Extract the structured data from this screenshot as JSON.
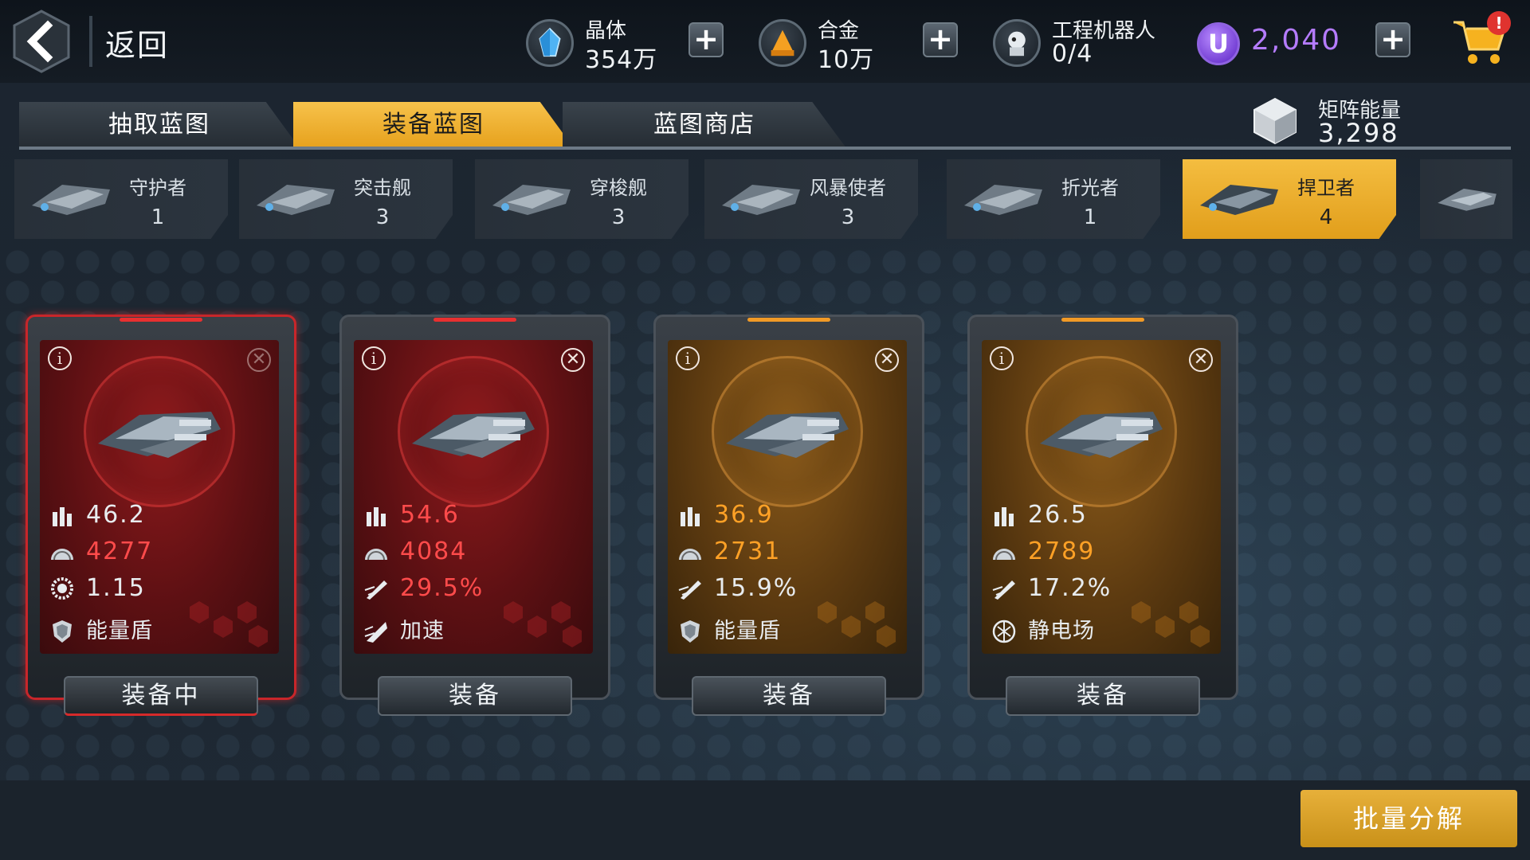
{
  "header": {
    "back_label": "返回",
    "resources": [
      {
        "name": "晶体",
        "value": "354万",
        "icon": "crystal-icon"
      },
      {
        "name": "合金",
        "value": "10万",
        "icon": "alloy-icon"
      },
      {
        "name": "工程机器人",
        "value": "0/4",
        "icon": "robot-icon"
      }
    ],
    "premium_value": "2,040",
    "premium_icon_letter": "U",
    "plus": "+",
    "cart_badge": "!"
  },
  "tabs": [
    {
      "label": "抽取蓝图",
      "active": false
    },
    {
      "label": "装备蓝图",
      "active": true
    },
    {
      "label": "蓝图商店",
      "active": false
    }
  ],
  "matrix": {
    "name": "矩阵能量",
    "value": "3,298"
  },
  "categories": [
    {
      "name": "守护者",
      "count": "1",
      "active": false
    },
    {
      "name": "突击舰",
      "count": "3",
      "active": false
    },
    {
      "name": "穿梭舰",
      "count": "3",
      "active": false
    },
    {
      "name": "风暴使者",
      "count": "3",
      "active": false
    },
    {
      "name": "折光者",
      "count": "1",
      "active": false
    },
    {
      "name": "捍卫者",
      "count": "4",
      "active": true
    }
  ],
  "cards": [
    {
      "rarity": "red",
      "equipped": true,
      "stats": [
        {
          "icon": "ammo-icon",
          "value": "46.2",
          "highlight": false
        },
        {
          "icon": "hull-icon",
          "value": "4277",
          "highlight": true
        },
        {
          "icon": "gear-icon",
          "value": "1.15",
          "highlight": false
        },
        {
          "icon": "shield-icon",
          "value": "能量盾",
          "highlight": false
        }
      ],
      "button": "装备中"
    },
    {
      "rarity": "red",
      "equipped": false,
      "stats": [
        {
          "icon": "ammo-icon",
          "value": "54.6",
          "highlight": true
        },
        {
          "icon": "hull-icon",
          "value": "4084",
          "highlight": true
        },
        {
          "icon": "speed-icon",
          "value": "29.5%",
          "highlight": true
        },
        {
          "icon": "boost-icon",
          "value": "加速",
          "highlight": false
        }
      ],
      "button": "装备"
    },
    {
      "rarity": "orange",
      "equipped": false,
      "stats": [
        {
          "icon": "ammo-icon",
          "value": "36.9",
          "highlight": true
        },
        {
          "icon": "hull-icon",
          "value": "2731",
          "highlight": true
        },
        {
          "icon": "speed-icon",
          "value": "15.9%",
          "highlight": false
        },
        {
          "icon": "shield-icon",
          "value": "能量盾",
          "highlight": false
        }
      ],
      "button": "装备"
    },
    {
      "rarity": "orange",
      "equipped": false,
      "stats": [
        {
          "icon": "ammo-icon",
          "value": "26.5",
          "highlight": false
        },
        {
          "icon": "hull-icon",
          "value": "2789",
          "highlight": true
        },
        {
          "icon": "speed-icon",
          "value": "17.2%",
          "highlight": false
        },
        {
          "icon": "static-field-icon",
          "value": "静电场",
          "highlight": false
        }
      ],
      "button": "装备"
    }
  ],
  "footer": {
    "batch_label": "批量分解"
  },
  "colors": {
    "accent": "#f2b633",
    "red_rarity": "#8e1a1c",
    "orange_rarity": "#8a5a1a",
    "highlight_red": "#ff4b4b",
    "highlight_orange": "#ffa126",
    "premium": "#b57cff"
  }
}
